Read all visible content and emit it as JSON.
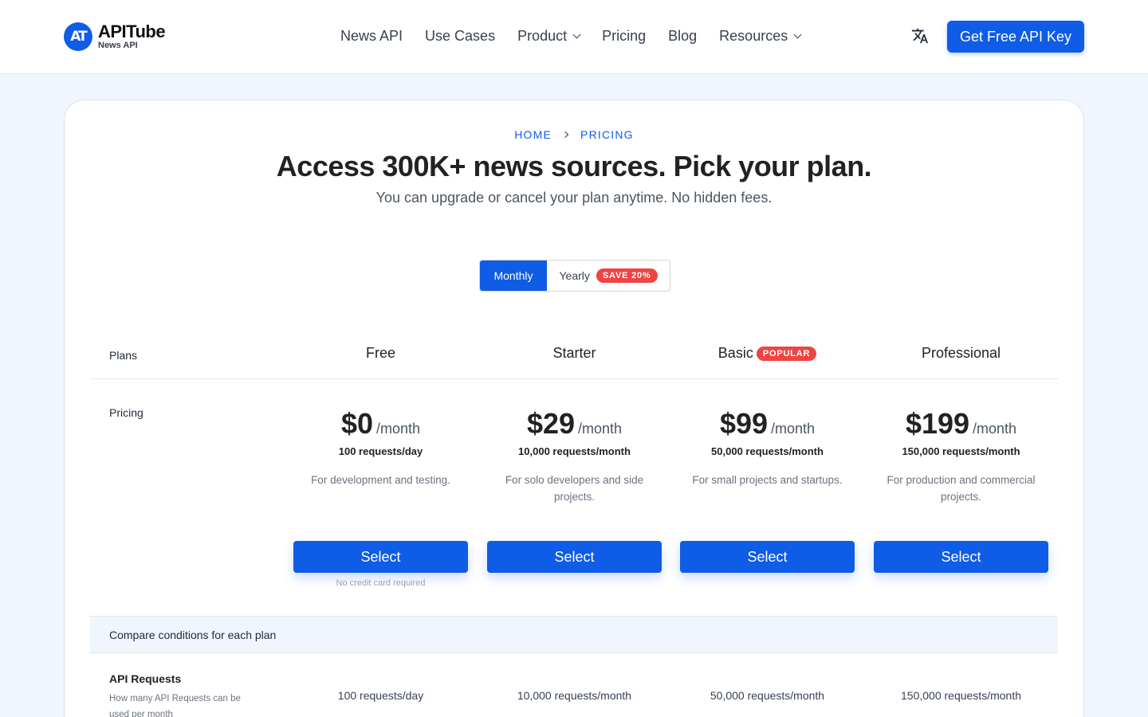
{
  "header": {
    "logo_mark": "AT",
    "logo_name": "APITube",
    "logo_sub": "News API",
    "nav": [
      {
        "label": "News API"
      },
      {
        "label": "Use Cases"
      },
      {
        "label": "Product",
        "dropdown": true
      },
      {
        "label": "Pricing"
      },
      {
        "label": "Blog"
      },
      {
        "label": "Resources",
        "dropdown": true
      }
    ],
    "lang_icon": "translate-icon",
    "cta_label": "Get Free API Key"
  },
  "breadcrumb": {
    "home": "HOME",
    "current": "PRICING"
  },
  "hero": {
    "title": "Access 300K+ news sources. Pick your plan.",
    "subtitle": "You can upgrade or cancel your plan anytime. No hidden fees."
  },
  "billing_toggle": {
    "monthly": "Monthly",
    "yearly": "Yearly",
    "save_badge": "SAVE 20%",
    "selected": "Monthly"
  },
  "table": {
    "plans_label": "Plans",
    "pricing_label": "Pricing",
    "popular_badge": "POPULAR",
    "per_label": "/month",
    "select_label": "Select",
    "no_credit_card": "No credit card required",
    "plans": [
      {
        "name": "Free",
        "price": "$0",
        "requests": "100 requests/day",
        "description": "For development and testing."
      },
      {
        "name": "Starter",
        "price": "$29",
        "requests": "10,000 requests/month",
        "description": "For solo developers and side projects."
      },
      {
        "name": "Basic",
        "price": "$99",
        "requests": "50,000 requests/month",
        "description": "For small projects and startups.",
        "popular": true
      },
      {
        "name": "Professional",
        "price": "$199",
        "requests": "150,000 requests/month",
        "description": "For production and commercial projects."
      }
    ],
    "compare_label": "Compare conditions for each plan",
    "features": [
      {
        "title": "API Requests",
        "description": "How many API Requests can be used per month",
        "values": [
          "100 requests/day",
          "10,000 requests/month",
          "50,000 requests/month",
          "150,000 requests/month"
        ]
      }
    ]
  },
  "colors": {
    "accent": "#0f5ce6",
    "badge": "#ef4444",
    "page_bg": "#f1f5fd"
  }
}
